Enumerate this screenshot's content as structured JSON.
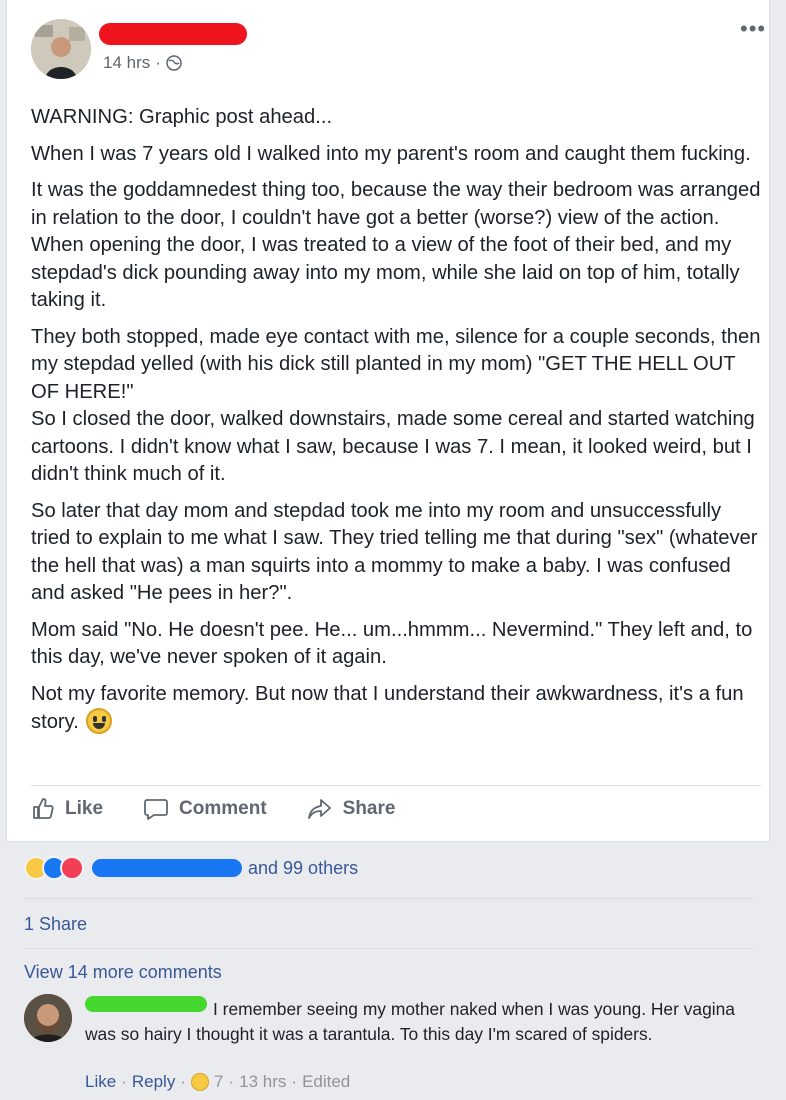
{
  "post": {
    "time": "14 hrs",
    "privacy_icon": "globe-icon",
    "paragraphs": [
      "WARNING: Graphic post ahead...",
      "When I was 7 years old I walked into my parent's room and caught them fucking.",
      "It was the goddamnedest thing too, because the way their bedroom was arranged in relation to the door, I couldn't have got a better (worse?) view of the action. When opening the door, I was treated to a view of the foot of their bed, and my stepdad's dick pounding away into my mom, while she laid on top of him, totally taking it.",
      "They both stopped, made eye contact with me, silence for a couple seconds, then my stepdad yelled (with his dick still planted in my mom) \"GET THE HELL OUT OF HERE!\"\nSo I closed the door, walked downstairs, made some cereal and started watching cartoons. I didn't know what I saw, because I was 7. I mean, it looked weird, but I didn't think much of it.",
      "So later that day mom and stepdad took me into my room and unsuccessfully tried to explain to me what I saw. They tried telling me that during \"sex\" (whatever the hell that was) a man squirts into a mommy to make a baby. I was confused and asked \"He pees in her?\".",
      "Mom said \"No. He doesn't pee. He... um...hmmm... Nevermind.\" They left and, to this day, we've never spoken of it again.",
      "Not my favorite memory. But now that I understand their awkwardness, it's a fun story."
    ]
  },
  "actions": {
    "like": "Like",
    "comment": "Comment",
    "share": "Share"
  },
  "reactions": {
    "others": "and 99 others",
    "shares": "1 Share"
  },
  "comments": {
    "view_more": "View 14 more comments",
    "items": [
      {
        "text": "I remember seeing my mother naked when I was young. Her vagina was so hairy I thought it was a tarantula. To this day I'm scared of spiders.",
        "like": "Like",
        "reply": "Reply",
        "reaction_count": "7",
        "time": "13 hrs",
        "edited": "Edited"
      }
    ]
  },
  "colors": {
    "link": "#385898",
    "muted": "#606770",
    "redact_red": "#f0141e",
    "redact_blue": "#1877f2",
    "redact_green": "#44d82f"
  }
}
